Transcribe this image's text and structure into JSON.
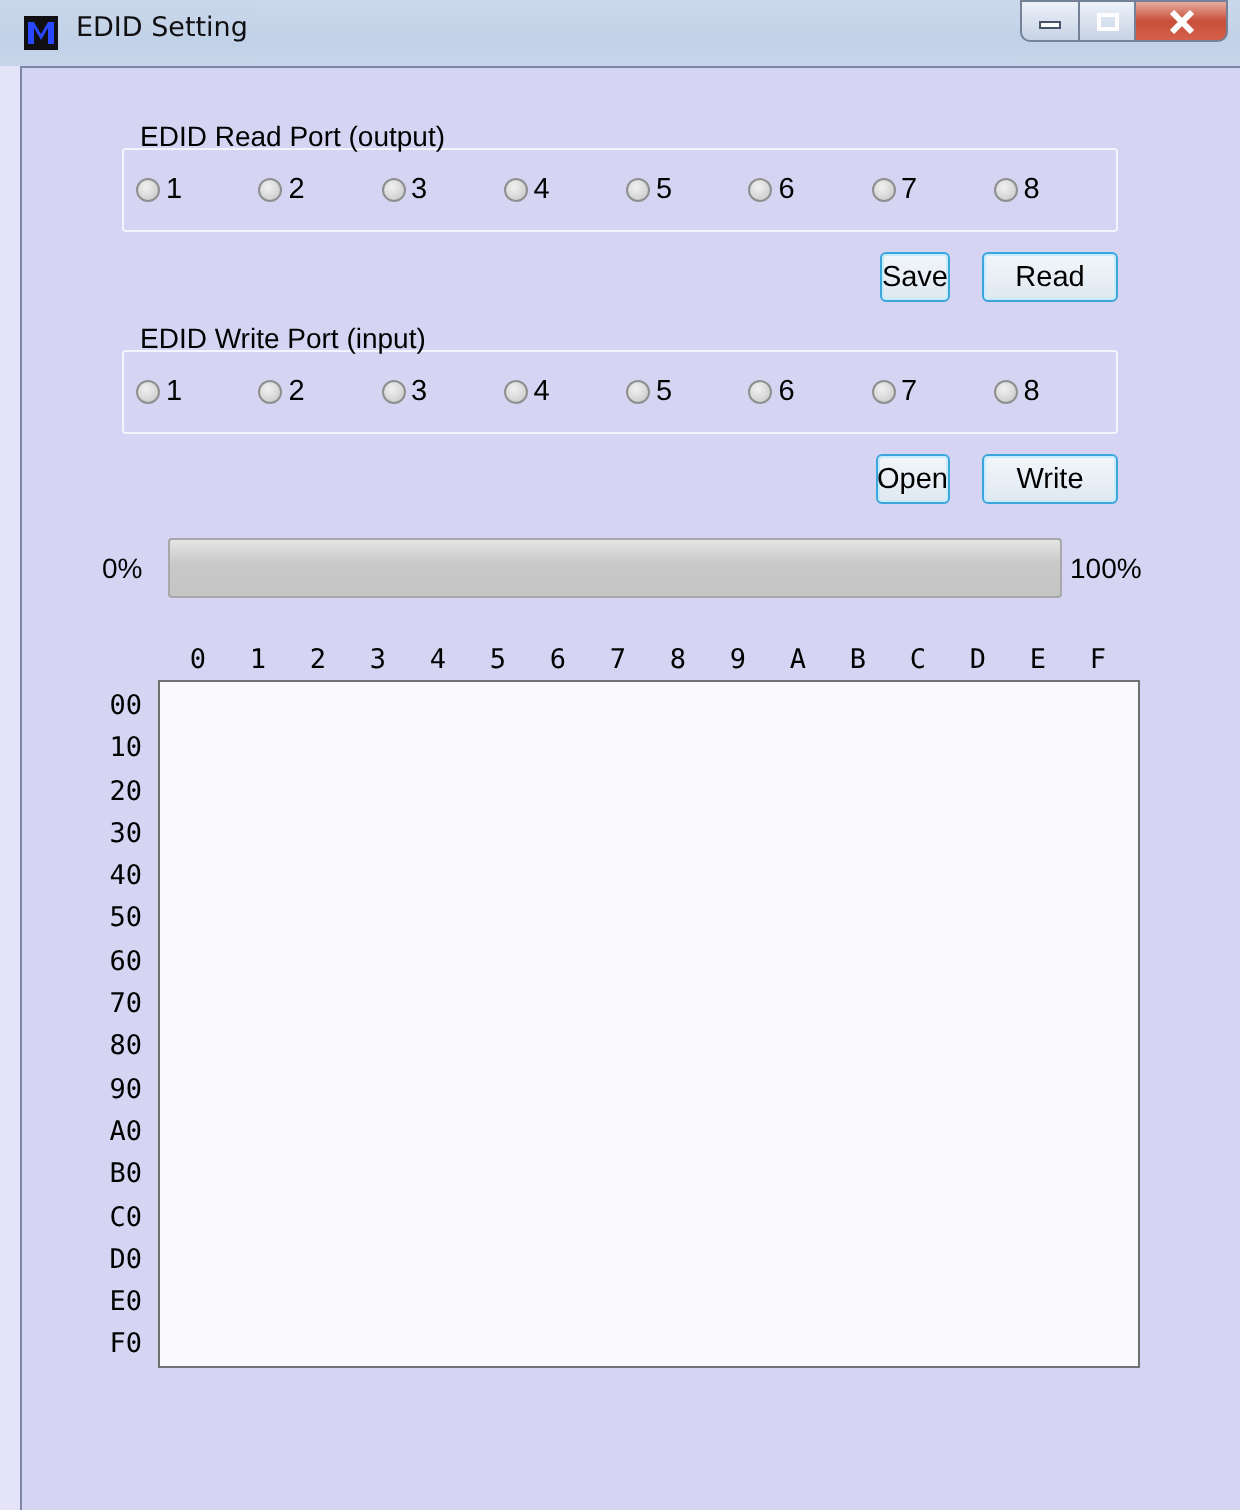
{
  "window": {
    "title": "EDID Setting"
  },
  "read_port": {
    "label": "EDID Read Port (output)",
    "ports": [
      {
        "label": "1",
        "selected": false
      },
      {
        "label": "2",
        "selected": false
      },
      {
        "label": "3",
        "selected": false
      },
      {
        "label": "4",
        "selected": false
      },
      {
        "label": "5",
        "selected": false
      },
      {
        "label": "6",
        "selected": false
      },
      {
        "label": "7",
        "selected": false
      },
      {
        "label": "8",
        "selected": false
      }
    ]
  },
  "read_buttons": [
    "Save",
    "Read"
  ],
  "write_port": {
    "label": "EDID Write Port (input)",
    "ports": [
      {
        "label": "1",
        "selected": false
      },
      {
        "label": "2",
        "selected": false
      },
      {
        "label": "3",
        "selected": false
      },
      {
        "label": "4",
        "selected": false
      },
      {
        "label": "5",
        "selected": false
      },
      {
        "label": "6",
        "selected": false
      },
      {
        "label": "7",
        "selected": false
      },
      {
        "label": "8",
        "selected": false
      }
    ]
  },
  "write_buttons": [
    "Open",
    "Write"
  ],
  "progress": {
    "start_label": "0%",
    "end_label": "100%",
    "level": 0
  },
  "hex_grid": {
    "column_headers": [
      "0",
      "1",
      "2",
      "3",
      "4",
      "5",
      "6",
      "7",
      "8",
      "9",
      "A",
      "B",
      "C",
      "D",
      "E",
      "F"
    ],
    "row_headers": [
      "00",
      "10",
      "20",
      "30",
      "40",
      "50",
      "60",
      "70",
      "80",
      "90",
      "A0",
      "B0",
      "C0",
      "D0",
      "E0",
      "F0"
    ]
  }
}
